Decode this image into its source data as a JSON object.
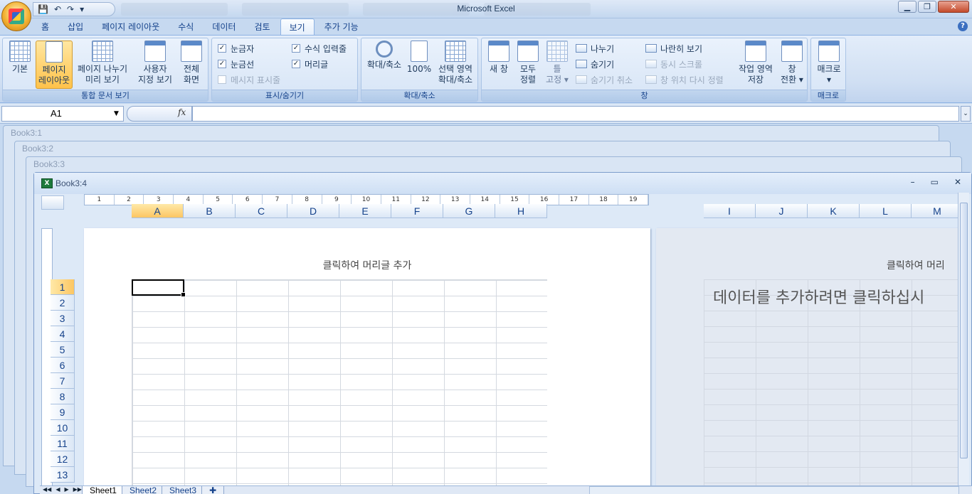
{
  "app_title": "Microsoft Excel",
  "quick_access": {
    "save": "💾",
    "undo": "↶",
    "redo": "↷",
    "customize": "▾"
  },
  "window_controls": {
    "minimize": "▁",
    "restore": "❐",
    "close": "✕"
  },
  "tabs": [
    "홈",
    "삽입",
    "페이지 레이아웃",
    "수식",
    "데이터",
    "검토",
    "보기",
    "추가 기능"
  ],
  "active_tab": "보기",
  "ribbon": {
    "workbook_views": {
      "label": "통합 문서 보기",
      "normal": [
        "기본"
      ],
      "page_layout": [
        "페이지",
        "레이아웃"
      ],
      "page_break": [
        "페이지 나누기",
        "미리 보기"
      ],
      "custom_views": [
        "사용자",
        "지정 보기"
      ],
      "full_screen": [
        "전체",
        "화면"
      ]
    },
    "show_hide": {
      "label": "표시/숨기기",
      "ruler": "눈금자",
      "gridlines": "눈금선",
      "message_bar": "메시지 표시줄",
      "formula_bar": "수식 입력줄",
      "headings": "머리글"
    },
    "zoom": {
      "label": "확대/축소",
      "zoom": "확대/축소",
      "hundred": "100%",
      "zoom_selection": [
        "선택 영역",
        "확대/축소"
      ]
    },
    "window": {
      "label": "창",
      "new_window": [
        "새 창"
      ],
      "arrange_all": [
        "모두",
        "정렬"
      ],
      "freeze": [
        "틀",
        "고정 ▾"
      ],
      "split": "나누기",
      "hide": "숨기기",
      "unhide": "숨기기 취소",
      "side_by_side": "나란히 보기",
      "sync_scroll": "동시 스크롤",
      "reset_position": "창 위치 다시 정렬",
      "save_workspace": [
        "작업 영역",
        "저장"
      ],
      "switch_windows": [
        "창",
        "전환 ▾"
      ]
    },
    "macros": {
      "label": "매크로",
      "macros": [
        "매크로",
        "▾"
      ]
    }
  },
  "formula_bar": {
    "name_box": "A1",
    "fx": "fx",
    "value": ""
  },
  "background_windows": [
    "Book3:1",
    "Book3:2",
    "Book3:3"
  ],
  "active_window": {
    "title": "Book3:4",
    "min": "–",
    "max": "▭",
    "close": "✕"
  },
  "ruler_numbers": [
    "1",
    "2",
    "3",
    "4",
    "5",
    "6",
    "7",
    "8",
    "9",
    "10",
    "11",
    "12",
    "13",
    "14",
    "15",
    "16",
    "17",
    "18",
    "19"
  ],
  "columns_page1": [
    "A",
    "B",
    "C",
    "D",
    "E",
    "F",
    "G",
    "H"
  ],
  "columns_page2": [
    "I",
    "J",
    "K",
    "L",
    "M"
  ],
  "rows": [
    "1",
    "2",
    "3",
    "4",
    "5",
    "6",
    "7",
    "8",
    "9",
    "10",
    "11",
    "12",
    "13"
  ],
  "header_hint": "클릭하여 머리글 추가",
  "header_hint_partial": "클릭하여 머리",
  "data_hint": "데이터를 추가하려면 클릭하십시",
  "sheet_tabs": [
    "Sheet1",
    "Sheet2",
    "Sheet3"
  ],
  "sheet_nav": [
    "◀◀",
    "◀",
    "▶",
    "▶▶"
  ],
  "colors": {
    "accent": "#15428b",
    "active_tab": "#ffc24a",
    "selection": "#fcc663"
  }
}
